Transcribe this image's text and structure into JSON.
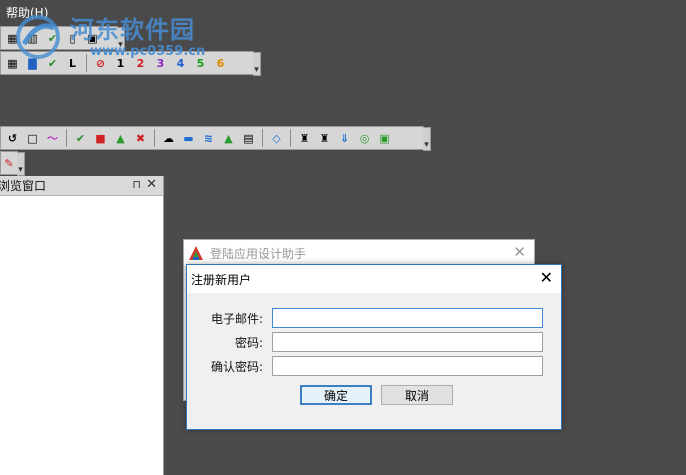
{
  "menu": {
    "help_label": "帮助(H)"
  },
  "watermark": {
    "title": "河东软件园",
    "url": "www.pc0359.cn"
  },
  "toolbar2": {
    "num_labels": [
      "1",
      "2",
      "3",
      "4",
      "5",
      "6"
    ]
  },
  "browse_panel": {
    "title": "浏览窗口",
    "pin_glyph": "⊓",
    "close_glyph": "✕"
  },
  "login_window": {
    "title": "登陆应用设计助手",
    "close_glyph": "✕"
  },
  "register_dialog": {
    "title": "注册新用户",
    "close_glyph": "✕",
    "fields": [
      {
        "label": "电子邮件:",
        "value": ""
      },
      {
        "label": "密码:",
        "value": ""
      },
      {
        "label": "确认密码:",
        "value": ""
      }
    ],
    "ok_label": "确定",
    "cancel_label": "取消"
  },
  "colors": {
    "background": "#4d4d4d",
    "toolbar": "#d6d6d6",
    "dialog_border": "#2b78c2",
    "button_default_border": "#3c7fc3"
  }
}
